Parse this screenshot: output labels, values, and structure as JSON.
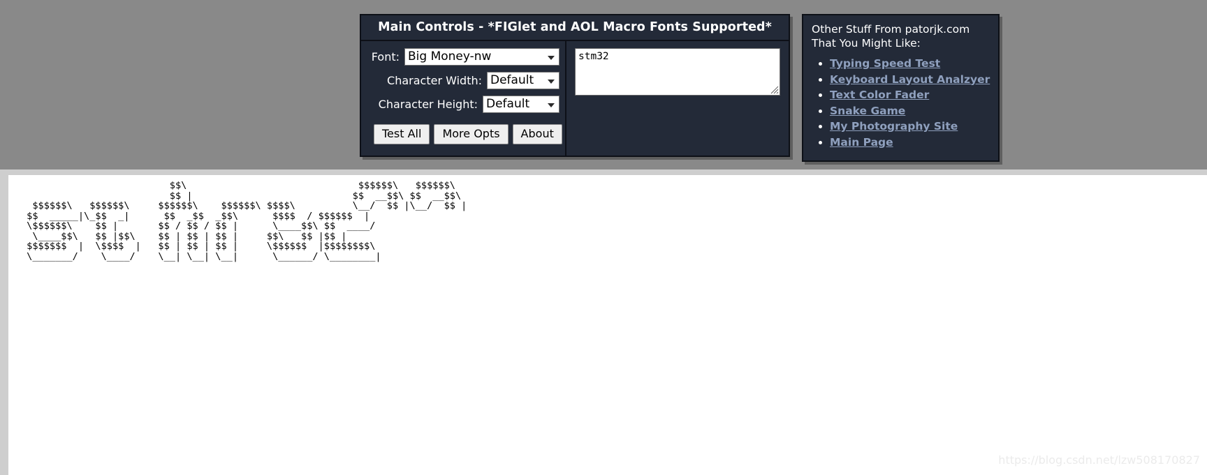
{
  "main_controls": {
    "title": "Main Controls - *FIGlet and AOL Macro Fonts Supported*",
    "font_label": "Font:",
    "font_value": "Big Money-nw",
    "char_width_label": "Character Width:",
    "char_width_value": "Default",
    "char_height_label": "Character Height:",
    "char_height_value": "Default",
    "buttons": {
      "test_all": "Test All",
      "more_opts": "More Opts",
      "about": "About"
    },
    "input": {
      "value": "stm32",
      "placeholder": ""
    }
  },
  "other_stuff": {
    "heading_line1": "Other Stuff From patorjk.com",
    "heading_line2": "That You Might Like:",
    "links": [
      {
        "label": "Typing Speed Test"
      },
      {
        "label": "Keyboard Layout Analzyer"
      },
      {
        "label": "Text Color Fader"
      },
      {
        "label": "Snake Game"
      },
      {
        "label": "My Photography Site"
      },
      {
        "label": "Main Page"
      }
    ]
  },
  "output": {
    "ascii_art": "                          $$\\                              $$$$$$\\   $$$$$$\\  \n                          $$ |                            $$  __$$\\ $$  __$$\\ \n  $$$$$$\\   $$$$$$\\     $$$$$$\\    $$$$$$\\ $$$$\\          \\__/  $$ |\\__/  $$ |\n $$  _____|\\_$$  _|      $$  _$$  _$$\\      $$$$  / $$$$$$  |\n \\$$$$$$\\    $$ |       $$ / $$ / $$ |      \\____$$\\ $$  ____/ \n  \\____$$\\   $$ |$$\\    $$ | $$ | $$ |     $$\\   $$ |$$ |      \n $$$$$$$  |  \\$$$$  |   $$ | $$ | $$ |     \\$$$$$$  |$$$$$$$$\\ \n \\_______/    \\____/    \\__| \\__| \\__|      \\______/ \\________|",
    "watermark": "https://blog.csdn.net/lzw508170827"
  },
  "colors": {
    "panel_bg": "#232a38",
    "panel_border": "#0d1017",
    "page_bg": "#898989",
    "link": "#8fa0be",
    "output_bg": "#ffffff"
  },
  "icons": {
    "dropdown_arrow": "chevron-down-icon",
    "resize_grip": "resize-grip-icon"
  }
}
